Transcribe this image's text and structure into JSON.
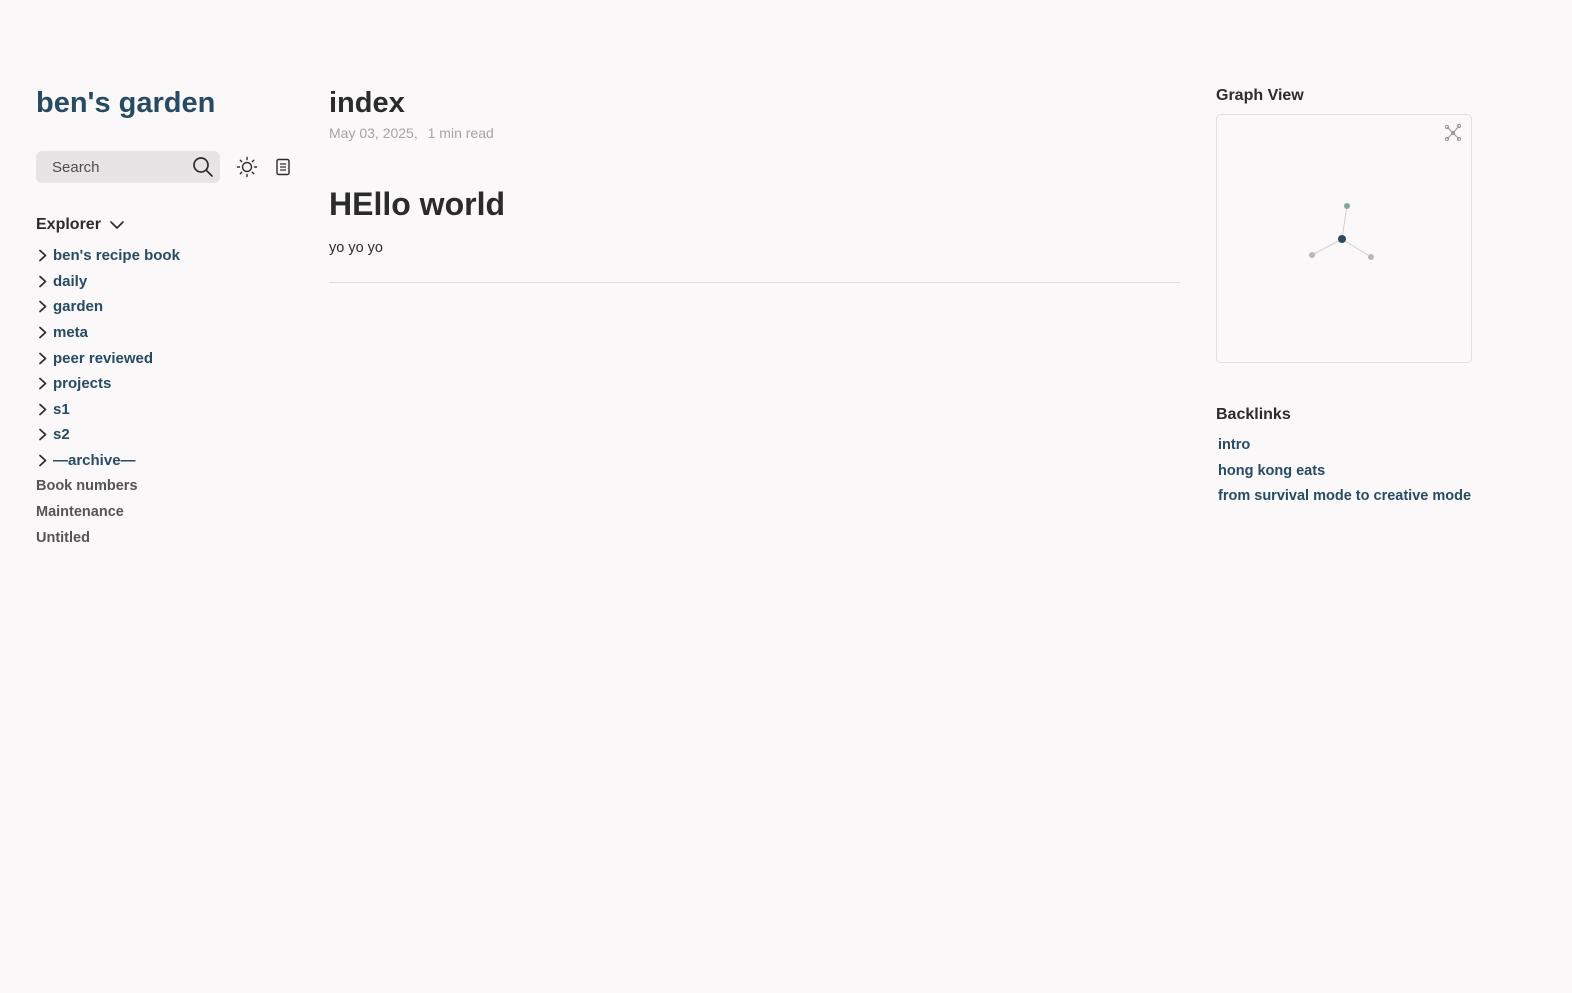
{
  "site": {
    "title": "ben's garden"
  },
  "search": {
    "placeholder": "Search"
  },
  "icons": {
    "search": "search-icon",
    "theme": "sun-icon",
    "reader": "document-icon",
    "explorer_toggle": "chevron-down-icon",
    "folder": "chevron-right-icon",
    "global_graph": "global-graph-icon"
  },
  "explorer": {
    "label": "Explorer",
    "folders": [
      "ben's recipe book",
      "daily",
      "garden",
      "meta",
      "peer reviewed",
      "projects",
      "s1",
      "s2",
      "—archive—"
    ],
    "files": [
      "Book numbers",
      "Maintenance",
      "Untitled"
    ]
  },
  "article": {
    "title": "index",
    "date": "May 03, 2025",
    "read_time": "1 min read",
    "heading": "HEllo world",
    "body": "yo yo yo"
  },
  "graph": {
    "title": "Graph View"
  },
  "backlinks": {
    "title": "Backlinks",
    "items": [
      "intro",
      "hong kong eats",
      "from survival mode to creative mode"
    ]
  },
  "colors": {
    "accent": "#284b63",
    "background": "#faf8f8",
    "text": "#2b2b2b",
    "muted": "#a5a5a5",
    "graph_current_node": "#284b63",
    "graph_visited_node": "#84a59d",
    "graph_other_node": "#b8b8b8"
  }
}
